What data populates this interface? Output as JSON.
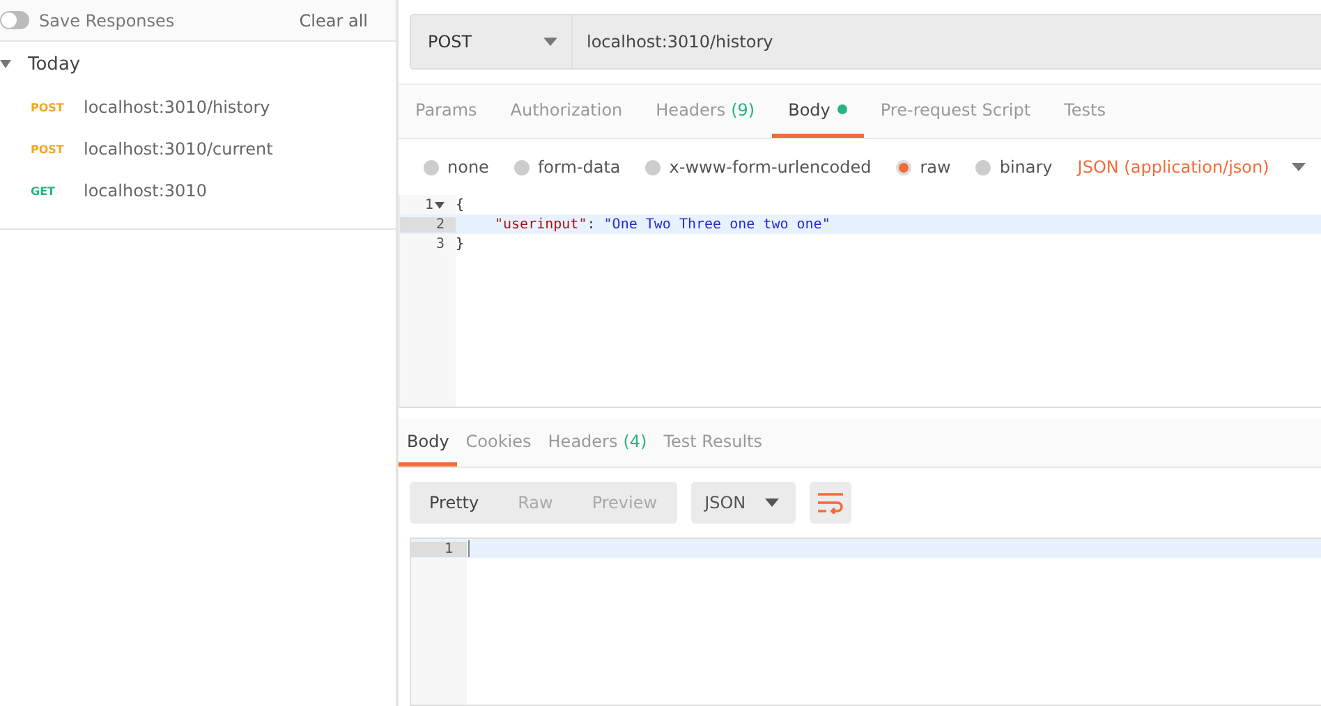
{
  "sidebar": {
    "save_responses": {
      "label": "Save Responses",
      "on": false
    },
    "clear_all": "Clear all",
    "groups": [
      {
        "label": "Today",
        "expanded": true,
        "items": [
          {
            "method": "POST",
            "kind": "post",
            "url": "localhost:3010/history"
          },
          {
            "method": "POST",
            "kind": "post",
            "url": "localhost:3010/current"
          },
          {
            "method": "GET",
            "kind": "get",
            "url": "localhost:3010"
          }
        ]
      }
    ]
  },
  "request": {
    "method": "POST",
    "url": "localhost:3010/history"
  },
  "tabs": [
    {
      "label": "Params",
      "selected": false
    },
    {
      "label": "Authorization",
      "selected": false
    },
    {
      "label": "Headers",
      "count": "(9)",
      "selected": false
    },
    {
      "label": "Body",
      "selected": true,
      "has_content": true
    },
    {
      "label": "Pre-request Script",
      "selected": false
    },
    {
      "label": "Tests",
      "selected": false
    }
  ],
  "body_modes": [
    {
      "label": "none",
      "selected": false
    },
    {
      "label": "form-data",
      "selected": false
    },
    {
      "label": "x-www-form-urlencoded",
      "selected": false
    },
    {
      "label": "raw",
      "selected": true
    },
    {
      "label": "binary",
      "selected": false
    }
  ],
  "body_format": "JSON (application/json)",
  "editor": {
    "lines": [
      {
        "number": "1",
        "foldable": true,
        "active": false,
        "indented": false,
        "tokens": [
          {
            "kind": "punct",
            "text": "{"
          }
        ]
      },
      {
        "number": "2",
        "foldable": false,
        "active": true,
        "indented": true,
        "tokens": [
          {
            "kind": "key",
            "text": "\"userinput\""
          },
          {
            "kind": "punct",
            "text": ": "
          },
          {
            "kind": "string",
            "text": "\"One Two Three one two one\""
          }
        ]
      },
      {
        "number": "3",
        "foldable": false,
        "active": false,
        "indented": false,
        "tokens": [
          {
            "kind": "punct",
            "text": "}"
          }
        ]
      }
    ]
  },
  "response": {
    "tabs": [
      {
        "label": "Body",
        "selected": true
      },
      {
        "label": "Cookies",
        "selected": false
      },
      {
        "label": "Headers",
        "count": "(4)",
        "selected": false
      },
      {
        "label": "Test Results",
        "selected": false
      }
    ],
    "views": [
      {
        "label": "Pretty",
        "selected": true
      },
      {
        "label": "Raw",
        "selected": false
      },
      {
        "label": "Preview",
        "selected": false
      }
    ],
    "format": "JSON",
    "lines": [
      {
        "number": "1",
        "active": true
      }
    ]
  }
}
